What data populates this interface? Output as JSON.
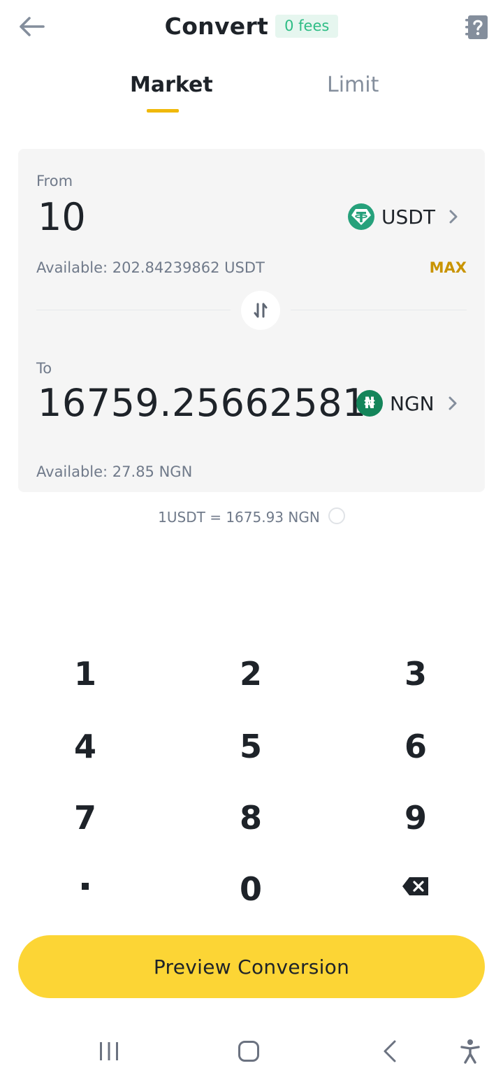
{
  "header": {
    "title": "Convert",
    "fees_badge": "0 fees"
  },
  "tabs": [
    {
      "label": "Market",
      "active": true
    },
    {
      "label": "Limit",
      "active": false
    }
  ],
  "from": {
    "label": "From",
    "amount": "10",
    "coin": "USDT",
    "available": "Available: 202.84239862 USDT",
    "max_label": "MAX"
  },
  "to": {
    "label": "To",
    "amount": "16759.25662581",
    "coin": "NGN",
    "coin_symbol": "₦",
    "available": "Available: 27.85 NGN"
  },
  "rate": "1USDT = 1675.93 NGN",
  "keypad": {
    "keys": [
      "1",
      "2",
      "3",
      "4",
      "5",
      "6",
      "7",
      "8",
      "9",
      ".",
      "0",
      "backspace"
    ]
  },
  "preview_button": "Preview Conversion",
  "colors": {
    "accent_yellow": "#fcd535",
    "tab_indicator": "#f0b90b",
    "fees_green": "#2ebd85",
    "max_gold": "#c99400",
    "usdt_green": "#26a17b",
    "ngn_green": "#14855a"
  },
  "icons": {
    "back": "back-arrow-icon",
    "help": "help-book-icon",
    "swap": "swap-arrows-icon",
    "backspace": "backspace-icon",
    "nav_recent": "recent-apps-icon",
    "nav_home": "home-icon",
    "nav_back": "nav-back-icon",
    "accessibility": "accessibility-icon"
  }
}
